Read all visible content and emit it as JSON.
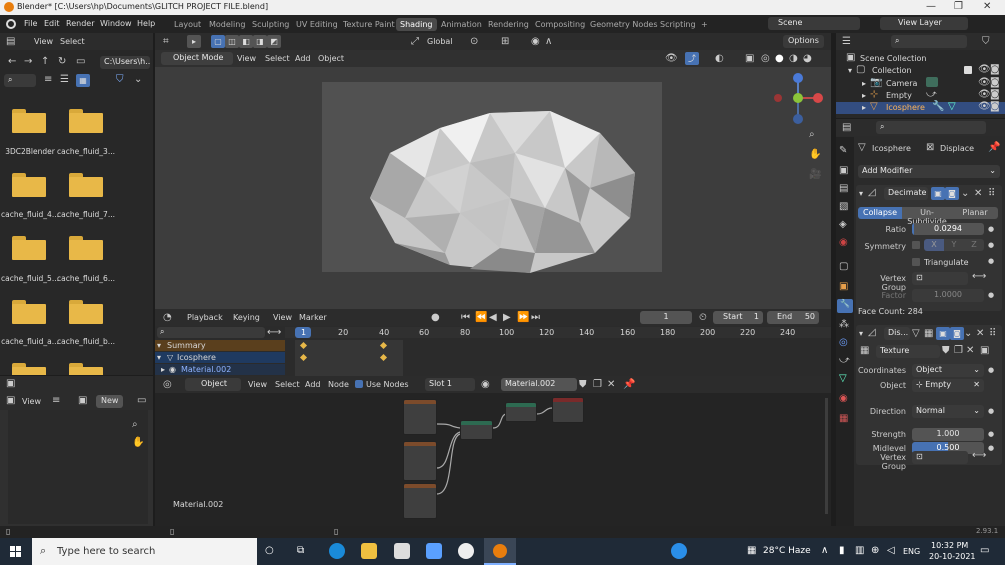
{
  "window": {
    "title": "Blender* [C:\\Users\\hp\\Documents\\GLITCH PROJECT FILE.blend]",
    "minimize": "—",
    "maximize": "❐",
    "close": "✕"
  },
  "menu": {
    "items": [
      "File",
      "Edit",
      "Render",
      "Window",
      "Help"
    ],
    "workspaces": [
      "Layout",
      "Modeling",
      "Sculpting",
      "UV Editing",
      "Texture Paint",
      "Shading",
      "Animation",
      "Rendering",
      "Compositing",
      "Geometry Nodes",
      "Scripting"
    ],
    "active_workspace": "Shading",
    "add_tab": "+",
    "scene": "Scene",
    "view_layer": "View Layer"
  },
  "file_browser": {
    "view_label": "View",
    "select_label": "Select",
    "path": "C:\\Users\\h...",
    "items": [
      "3DC2Blender",
      "cache_fluid_3...",
      "cache_fluid_4...",
      "cache_fluid_7...",
      "cache_fluid_5...",
      "cache_fluid_6...",
      "cache_fluid_a...",
      "cache_fluid_b..."
    ]
  },
  "viewport": {
    "mode": "Object Mode",
    "menus": [
      "View",
      "Select",
      "Add",
      "Object"
    ],
    "transform": "Global",
    "options": "Options"
  },
  "timeline": {
    "menus": [
      "Playback",
      "Keying",
      "View",
      "Marker"
    ],
    "current_frame": "1",
    "start_label": "Start",
    "start": "1",
    "end_label": "End",
    "end": "50",
    "ticks": [
      "1",
      "20",
      "40",
      "60",
      "80",
      "100",
      "120",
      "140",
      "160",
      "180",
      "200",
      "220",
      "240"
    ],
    "channels": [
      "Summary",
      "Icosphere",
      "Material.002"
    ]
  },
  "image_editor": {
    "view_label": "View",
    "new_label": "New"
  },
  "node_editor": {
    "object_label": "Object",
    "menus": [
      "View",
      "Select",
      "Add",
      "Node"
    ],
    "use_nodes": "Use Nodes",
    "slot": "Slot 1",
    "material": "Material.002",
    "material_label": "Material.002"
  },
  "outliner": {
    "scene_collection": "Scene Collection",
    "collection": "Collection",
    "objects": [
      "Camera",
      "Empty",
      "Icosphere"
    ]
  },
  "properties": {
    "object_name": "Icosphere",
    "modifier_crumb": "Displace",
    "add_modifier": "Add Modifier",
    "decimate": {
      "name": "Decimate",
      "tabs": [
        "Collapse",
        "Un-Subdivide",
        "Planar"
      ],
      "ratio_label": "Ratio",
      "ratio": "0.0294",
      "ratio_fill": 0.0294,
      "symmetry_label": "Symmetry",
      "axes": [
        "X",
        "Y",
        "Z"
      ],
      "triangulate": "Triangulate",
      "vertex_group_label": "Vertex Group",
      "factor_label": "Factor",
      "factor": "1.0000",
      "face_count": "Face Count: 284"
    },
    "displace": {
      "name": "Dis...",
      "texture": "Texture",
      "coordinates_label": "Coordinates",
      "coordinates": "Object",
      "object_label": "Object",
      "object": "Empty",
      "direction_label": "Direction",
      "direction": "Normal",
      "strength_label": "Strength",
      "strength": "1.000",
      "midlevel_label": "Midlevel",
      "midlevel": "0.500",
      "midlevel_fill": 0.5,
      "vertex_group_label": "Vertex Group"
    }
  },
  "status": {
    "version": "2.93.1"
  },
  "taskbar": {
    "search_placeholder": "Type here to search",
    "weather": "28°C Haze",
    "lang": "ENG",
    "time": "10:32 PM",
    "date": "20-10-2021"
  },
  "colors": {
    "accent_blue": "#4772b3",
    "folder": "#e8b848",
    "keyframe": "#e8b848"
  }
}
